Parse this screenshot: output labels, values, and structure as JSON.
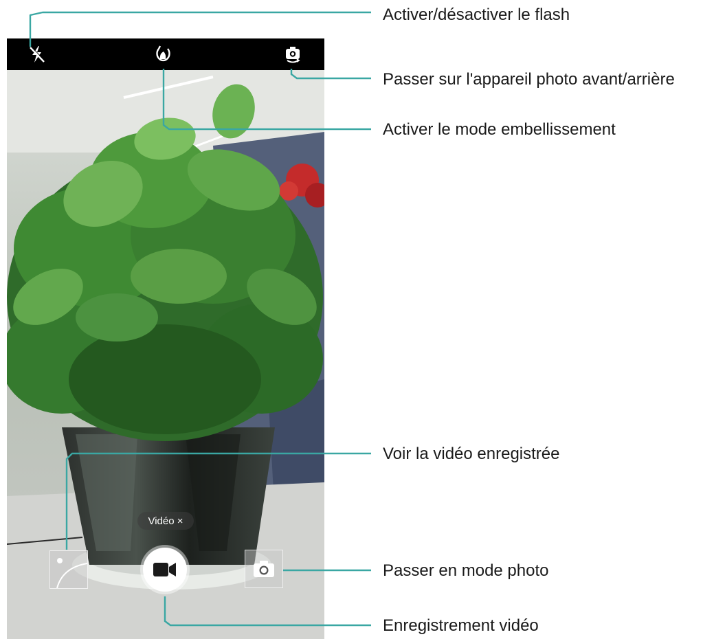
{
  "camera": {
    "mode_chip_label": "Vidéo ×",
    "icons": {
      "flash": "flash-off-icon",
      "beauty": "beauty-icon",
      "switch_camera": "switch-camera-icon",
      "record": "video-camera-icon",
      "photo_mode": "camera-icon",
      "gallery": "gallery-thumbnail"
    },
    "colors": {
      "topbar": "#000000",
      "callout_line": "#3aa7a3",
      "record_button": "#ffffff"
    }
  },
  "callouts": {
    "flash": "Activer/désactiver le flash",
    "switch_camera": "Passer sur l'appareil photo avant/arrière",
    "beauty": "Activer le mode embellissement",
    "view_video": "Voir la vidéo enregistrée",
    "photo_mode": "Passer en mode photo",
    "record": "Enregistrement vidéo"
  }
}
